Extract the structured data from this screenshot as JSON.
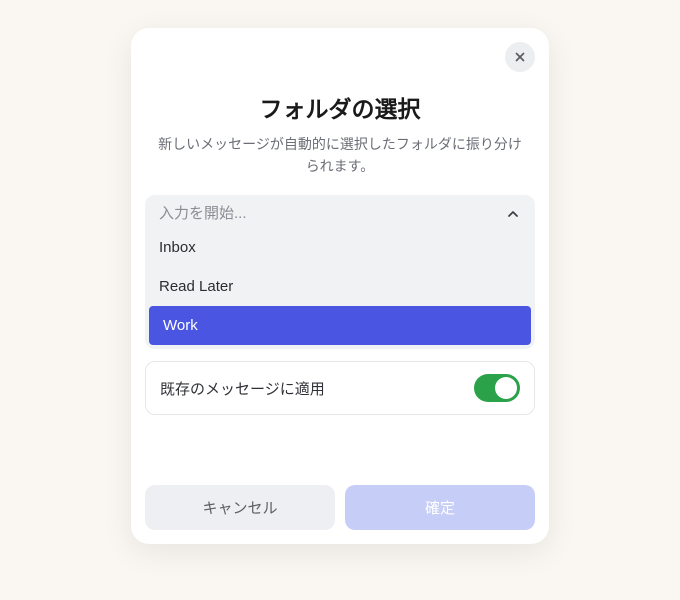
{
  "modal": {
    "title": "フォルダの選択",
    "subtitle": "新しいメッセージが自動的に選択したフォルダに振り分けられます。",
    "combobox": {
      "placeholder": "入力を開始...",
      "options": [
        {
          "label": "Inbox",
          "selected": false
        },
        {
          "label": "Read Later",
          "selected": false
        },
        {
          "label": "Work",
          "selected": true
        }
      ]
    },
    "apply_existing": {
      "label": "既存のメッセージに適用",
      "enabled": true
    },
    "buttons": {
      "cancel": "キャンセル",
      "confirm": "確定"
    }
  }
}
